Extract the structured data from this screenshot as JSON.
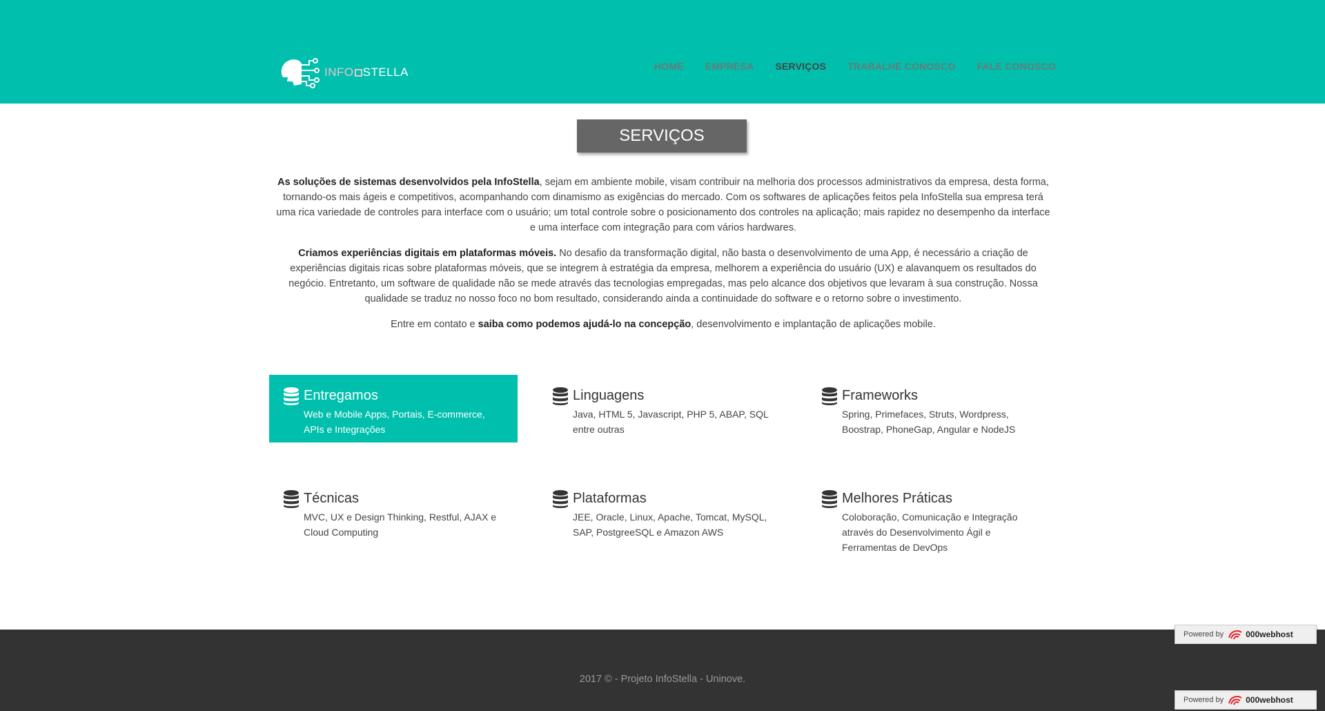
{
  "header": {
    "logo_text_left": "INFO",
    "logo_text_right": "STELLA",
    "nav": [
      {
        "label": "HOME"
      },
      {
        "label": "EMPRESA"
      },
      {
        "label": "SERVIÇOS",
        "active": true
      },
      {
        "label": "TRABALHE CONOSCO"
      },
      {
        "label": "FALE CONOSCO"
      }
    ]
  },
  "page_title": "SERVIÇOS",
  "paragraphs": [
    {
      "bold": "As soluções de sistemas desenvolvidos pela InfoStella",
      "text": ", sejam em ambiente mobile, visam contribuir na melhoria dos processos administrativos da empresa, desta forma, tornando-os mais ágeis e competitivos, acompanhando com dinamismo as exigências do mercado. Com os softwares de aplicações feitos pela InfoStella sua empresa terá uma rica variedade de controles para interface com o usuário; um total controle sobre o posicionamento dos controles na aplicação; mais rapidez no desempenho da interface e uma interface com integração para com vários hardwares."
    },
    {
      "bold": "Criamos experiências digitais em plataformas móveis.",
      "text": " No desafio da transformação digital, não basta o desenvolvimento de uma App, é necessário a criação de experiências digitais ricas sobre plataformas móveis, que se integrem à estratégia da empresa, melhorem a experiência do usuário (UX) e alavanquem os resultados do negócio. Entretanto, um software de qualidade não se mede através das tecnologias empregadas, mas pelo alcance dos objetivos que levaram à sua construção. Nossa qualidade se traduz no nosso foco no bom resultado, considerando ainda a continuidade do software e o retorno sobre o investimento."
    }
  ],
  "contact_line": {
    "before": "Entre em contato e ",
    "bold": "saiba como podemos ajudá-lo na concepção",
    "after": ", desenvolvimento e implantação de aplicações mobile."
  },
  "services": [
    {
      "title": "Entregamos",
      "desc": "Web e Mobile Apps, Portais, E-commerce, APIs e Integrações",
      "icon": "database-icon",
      "active": true
    },
    {
      "title": "Linguagens",
      "desc": "Java, HTML 5, Javascript, PHP 5, ABAP, SQL entre outras",
      "icon": "database-icon"
    },
    {
      "title": "Frameworks",
      "desc": "Spring, Primefaces, Struts, Wordpress, Boostrap, PhoneGap, Angular e NodeJS",
      "icon": "database-icon"
    },
    {
      "title": "Técnicas",
      "desc": "MVC, UX e Design Thinking, Restful, AJAX e Cloud Computing",
      "icon": "database-icon"
    },
    {
      "title": "Plataformas",
      "desc": "JEE, Oracle, Linux, Apache, Tomcat, MySQL, SAP, PostgreeSQL e Amazon AWS",
      "icon": "database-icon"
    },
    {
      "title": "Melhores Práticas",
      "desc": "Coloboração, Comunicação e Integração através do Desenvolvimento Ágil e Ferramentas de DevOps",
      "icon": "database-icon"
    }
  ],
  "footer": {
    "text": "2017 © - Projeto InfoStella - Uninove."
  },
  "webhost_badge": {
    "powered": "Powered by",
    "brand": "000webhost"
  },
  "colors": {
    "accent": "#00bfad",
    "footer_bg": "#333333",
    "title_box": "#666666"
  }
}
